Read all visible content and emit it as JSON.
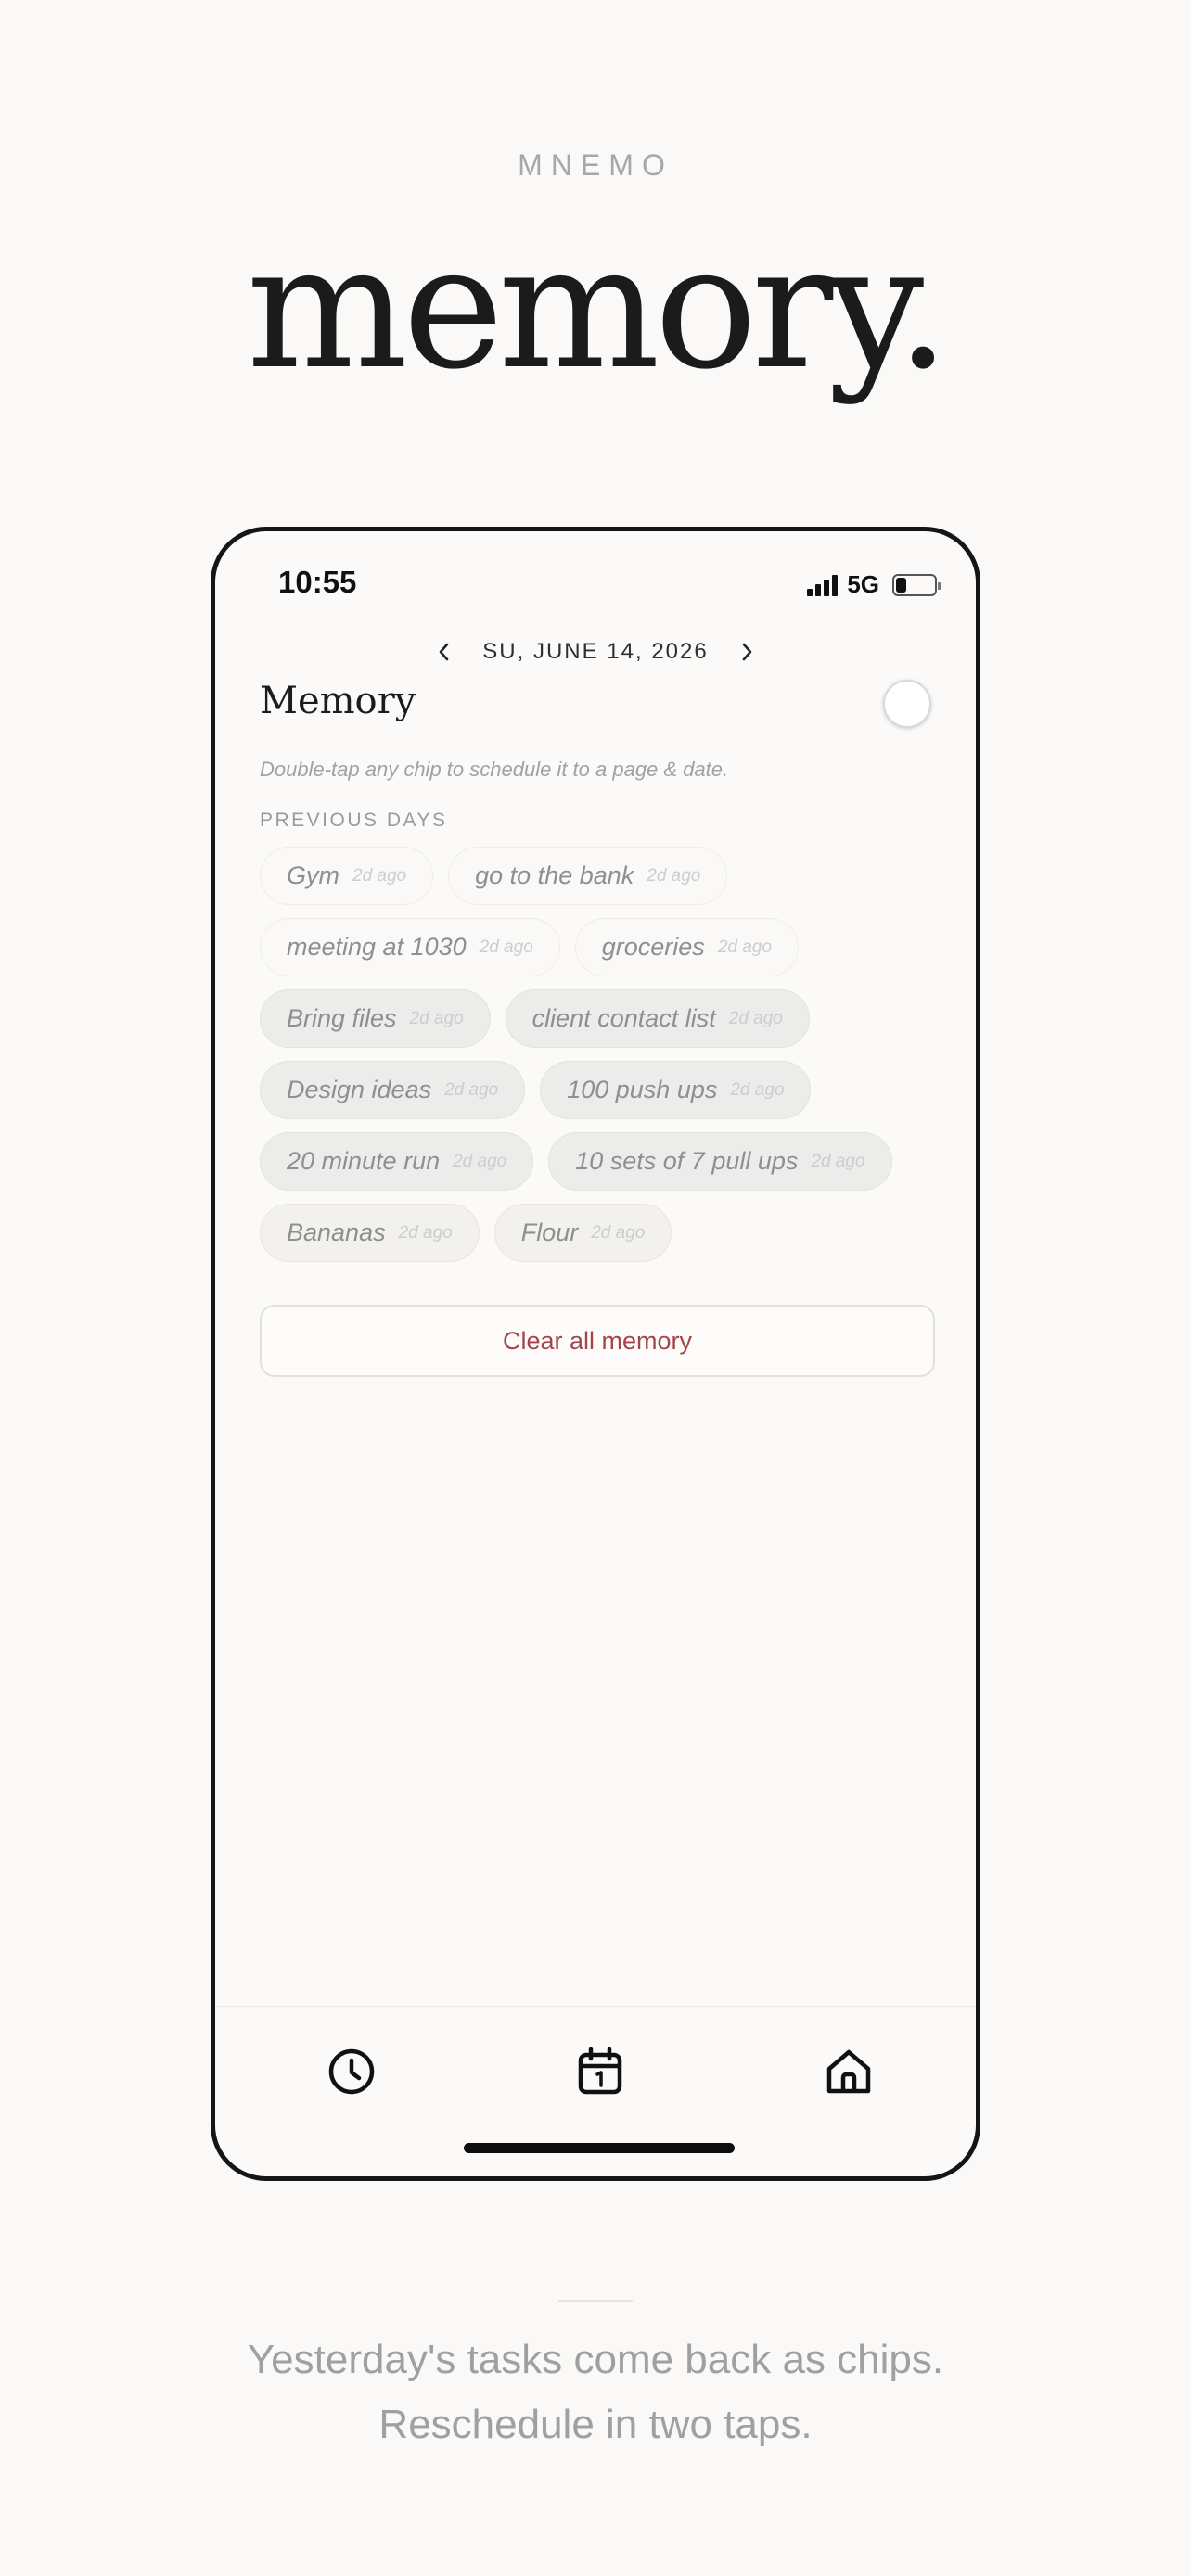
{
  "brand": "MNEMO",
  "hero": "memory.",
  "status": {
    "time": "10:55",
    "network": "5G",
    "battery_level": 0.3
  },
  "date_nav": {
    "label": "SU, JUNE 14, 2026",
    "prev_icon": "chevron-left-icon",
    "next_icon": "chevron-right-icon"
  },
  "screen": {
    "title": "Memory",
    "hint": "Double-tap any chip to schedule it to a page & date.",
    "section_label": "PREVIOUS DAYS"
  },
  "chips": [
    {
      "text": "Gym",
      "age": "2d ago",
      "tone": 1
    },
    {
      "text": "go to the bank",
      "age": "2d ago",
      "tone": 1
    },
    {
      "text": "meeting at 1030",
      "age": "2d ago",
      "tone": 1
    },
    {
      "text": "groceries",
      "age": "2d ago",
      "tone": 1
    },
    {
      "text": "Bring files",
      "age": "2d ago",
      "tone": 2
    },
    {
      "text": "client contact list",
      "age": "2d ago",
      "tone": 2
    },
    {
      "text": "Design ideas",
      "age": "2d ago",
      "tone": 2
    },
    {
      "text": "100 push ups",
      "age": "2d ago",
      "tone": 2
    },
    {
      "text": "20 minute run",
      "age": "2d ago",
      "tone": 2
    },
    {
      "text": "10 sets of 7 pull ups",
      "age": "2d ago",
      "tone": 2
    },
    {
      "text": "Bananas",
      "age": "2d ago",
      "tone": 3
    },
    {
      "text": "Flour",
      "age": "2d ago",
      "tone": 3
    }
  ],
  "clear_button": {
    "label": "Clear all memory",
    "color": "#a4454b"
  },
  "tabs": [
    {
      "icon": "clock-icon"
    },
    {
      "icon": "calendar-icon"
    },
    {
      "icon": "home-icon"
    }
  ],
  "caption": {
    "line1": "Yesterday's tasks come back as chips.",
    "line2": "Reschedule in two taps."
  }
}
